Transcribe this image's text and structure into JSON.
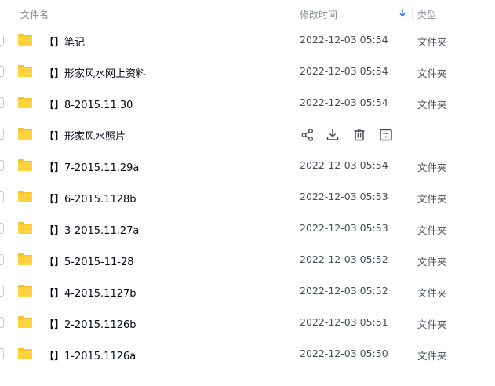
{
  "header": {
    "name_label": "文件名",
    "time_label": "修改时间",
    "type_label": "类型",
    "sort_icon": "arrow-down-icon"
  },
  "rows": [
    {
      "name": "【】笔记",
      "time": "2022-12-03 05:54",
      "type": "文件夹"
    },
    {
      "name": "【】形家风水网上资料",
      "time": "2022-12-03 05:54",
      "type": "文件夹"
    },
    {
      "name": "【】8-2015.11.30",
      "time": "2022-12-03 05:54",
      "type": "文件夹"
    },
    {
      "name": "【】形家风水照片",
      "time": "",
      "type": ""
    },
    {
      "name": "【】7-2015.11.29a",
      "time": "2022-12-03 05:54",
      "type": "文件夹"
    },
    {
      "name": "【】6-2015.1128b",
      "time": "2022-12-03 05:53",
      "type": "文件夹"
    },
    {
      "name": "【】3-2015.11.27a",
      "time": "2022-12-03 05:53",
      "type": "文件夹"
    },
    {
      "name": "【】5-2015-11-28",
      "time": "2022-12-03 05:52",
      "type": "文件夹"
    },
    {
      "name": "【】4-2015.1127b",
      "time": "2022-12-03 05:52",
      "type": "文件夹"
    },
    {
      "name": "【】2-2015.1126b",
      "time": "2022-12-03 05:51",
      "type": "文件夹"
    },
    {
      "name": "【】1-2015.1126a",
      "time": "2022-12-03 05:50",
      "type": "文件夹"
    }
  ],
  "hover_actions": [
    "share-icon",
    "download-icon",
    "trash-icon",
    "more-icon"
  ],
  "colors": {
    "folder": "#ffd33d",
    "folder_back": "#f5c12e",
    "text_primary": "#03081a",
    "text_secondary": "#454d5a",
    "header_text": "#878c9c",
    "accent": "#2f7bff"
  }
}
